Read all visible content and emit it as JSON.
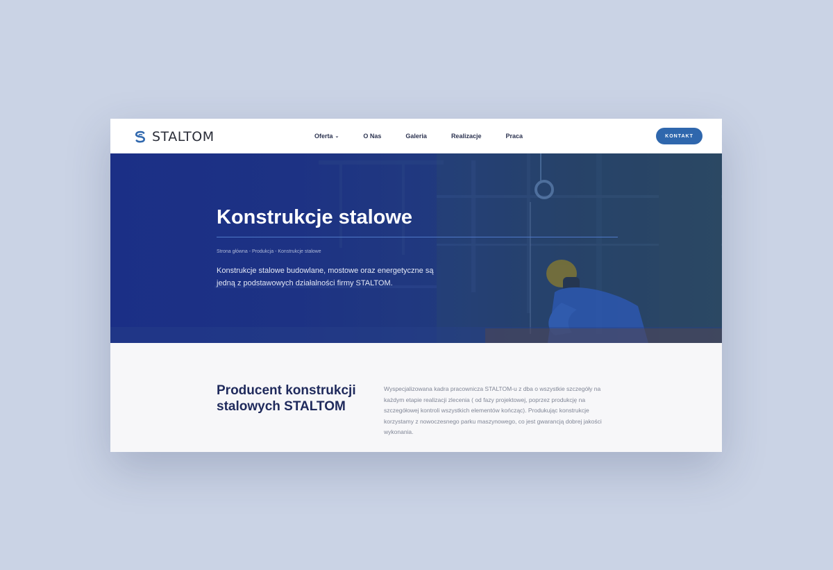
{
  "brand": {
    "logo_text": "STALTOM",
    "accent": "#2f67ad",
    "dark": "#1f2a5c"
  },
  "nav": {
    "items": [
      {
        "label": "Oferta",
        "has_dropdown": true
      },
      {
        "label": "O Nas"
      },
      {
        "label": "Galeria"
      },
      {
        "label": "Realizacje"
      },
      {
        "label": "Praca"
      }
    ],
    "dropdown_icon": "chevron-down-icon"
  },
  "header": {
    "contact_label": "KONTAKT"
  },
  "hero": {
    "title": "Konstrukcje stalowe",
    "breadcrumb": [
      "Strona główna",
      "Produkcja",
      "Konstrukcje stalowe"
    ],
    "breadcrumb_separator": " - ",
    "description": "Konstrukcje stalowe budowlane, mostowe oraz energetyczne są jedną z podstawowych działalności firmy STALTOM."
  },
  "intro": {
    "title": "Producent konstrukcji stalowych STALTOM",
    "text": "Wyspecjalizowana kadra pracownicza STALTOM-u z dba o wszystkie szczegóły na każdym etapie realizacji zlecenia ( od fazy projektowej, poprzez produkcję na szczegółowej kontroli wszystkich elementów kończąc). Produkując konstrukcje korzystamy z nowoczesnego parku maszynowego, co jest gwarancją dobrej jakości wykonania."
  }
}
